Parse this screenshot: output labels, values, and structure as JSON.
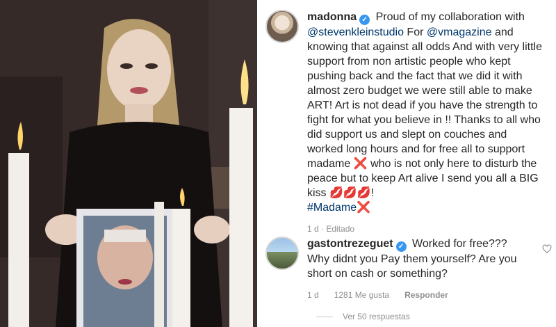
{
  "post": {
    "username": "madonna",
    "verified_glyph": "✓",
    "caption": {
      "p1": "Proud of my collaboration with",
      "mention1": "@stevenkleinstudio",
      "p2": " For ",
      "mention2": "@vmagazine",
      "p3": " and knowing that against all odds And with very little support from non artistic people  who kept pushing back and the fact that we did it with almost zero budget we were still able to make ART! Art  is not dead if you have the strength  to fight for what you believe in !! Thanks to all who did support us and slept on couches and worked long hours and  for free all to support madame ",
      "x1": "❌",
      "p4": " who is not only here to disturb the peace but to keep Art  alive I send  you all a BIG kiss ",
      "kisses": "💋💋💋",
      "p5": "!",
      "hashtag": "#Madame",
      "x2": "❌"
    },
    "time": "1 d",
    "edited": "Editado"
  },
  "comment": {
    "username": "gastontrezeguet",
    "verified_glyph": "✓",
    "text": "Worked for free??? Why didnt you Pay them yourself? Are you short on cash or something?",
    "time": "1 d",
    "likes": "1281 Me gusta",
    "reply": "Responder",
    "view_replies": "Ver 50 respuestas"
  },
  "colors": {
    "link": "#00376b",
    "meta": "#8e8e8e",
    "verified": "#3897f0",
    "x_red": "#e0243b"
  }
}
